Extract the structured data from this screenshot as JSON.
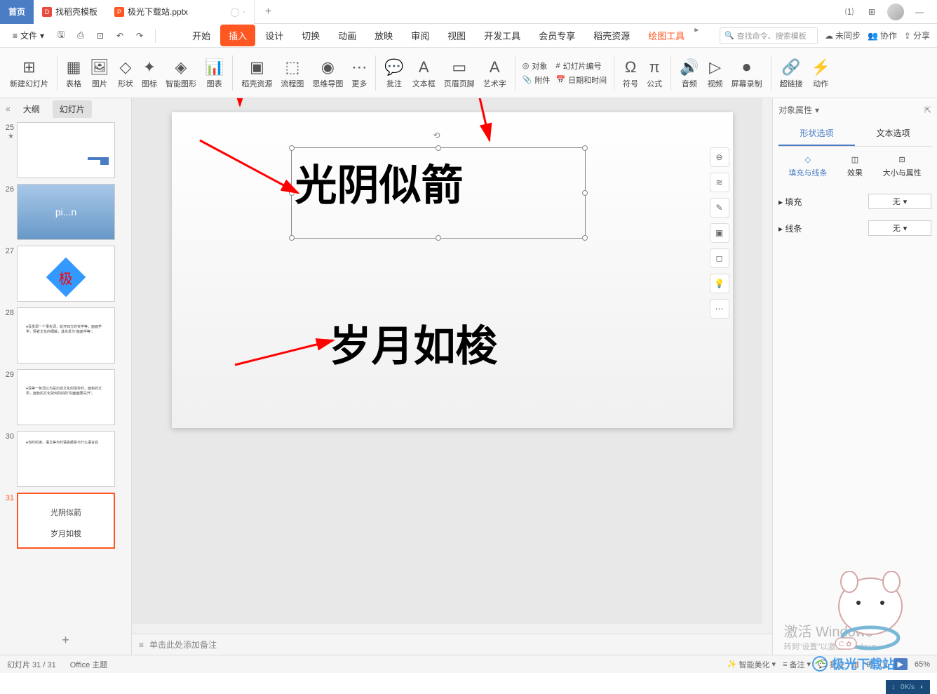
{
  "titlebar": {
    "home": "首页",
    "template": "找稻壳模板",
    "doc_name": "极光下载站.pptx",
    "add": "+"
  },
  "menubar": {
    "file": "文件",
    "tabs": [
      "开始",
      "插入",
      "设计",
      "切换",
      "动画",
      "放映",
      "审阅",
      "视图",
      "开发工具",
      "会员专享",
      "稻壳资源",
      "绘图工具"
    ],
    "active_idx": 1,
    "search_placeholder": "查找命令、搜索模板",
    "unsync": "未同步",
    "collab": "协作",
    "share": "分享"
  },
  "ribbon": {
    "items": [
      {
        "icon": "⊞",
        "label": "新建幻灯片"
      },
      {
        "icon": "▦",
        "label": "表格"
      },
      {
        "icon": "🖼",
        "label": "图片"
      },
      {
        "icon": "◇",
        "label": "形状"
      },
      {
        "icon": "✦",
        "label": "图标"
      },
      {
        "icon": "◈",
        "label": "智能图形"
      },
      {
        "icon": "📊",
        "label": "图表"
      },
      {
        "icon": "▣",
        "label": "稻壳资源"
      },
      {
        "icon": "⬚",
        "label": "流程图"
      },
      {
        "icon": "◉",
        "label": "思维导图"
      },
      {
        "icon": "⋯",
        "label": "更多"
      },
      {
        "icon": "💬",
        "label": "批注"
      },
      {
        "icon": "A",
        "label": "文本框"
      },
      {
        "icon": "▭",
        "label": "页眉页脚"
      },
      {
        "icon": "A",
        "label": "艺术字"
      }
    ],
    "small1": [
      {
        "icon": "◎",
        "label": "对象"
      },
      {
        "icon": "📎",
        "label": "附件"
      }
    ],
    "small2": [
      {
        "icon": "#",
        "label": "幻灯片编号"
      },
      {
        "icon": "📅",
        "label": "日期和时间"
      }
    ],
    "items2": [
      {
        "icon": "Ω",
        "label": "符号"
      },
      {
        "icon": "π",
        "label": "公式"
      },
      {
        "icon": "🔊",
        "label": "音频"
      },
      {
        "icon": "▷",
        "label": "视频"
      },
      {
        "icon": "⏺",
        "label": "屏幕录制"
      },
      {
        "icon": "🔗",
        "label": "超链接"
      },
      {
        "icon": "⚡",
        "label": "动作"
      }
    ]
  },
  "sidebar": {
    "tab_outline": "大纲",
    "tab_slides": "幻灯片",
    "thumbs": [
      {
        "num": "25",
        "star": true
      },
      {
        "num": "26",
        "img": true,
        "text": "pi...n"
      },
      {
        "num": "27",
        "diamond": true,
        "text": "极"
      },
      {
        "num": "28",
        "text": "●没发现一个事实词，就开四方的资学等，面面学学，情者文化的细解，其先发为\"面面学等\"。"
      },
      {
        "num": "29",
        "text": "●没等一色词以为是出自文化的情务时，面色的文学，面色的文化如何的四的\"如面面要先开\"。"
      },
      {
        "num": "30",
        "text": "●当时的读，语文等与时语意都意与什么语言后"
      },
      {
        "num": "31",
        "selected": true,
        "line1": "光阴似箭",
        "line2": "岁月如梭"
      }
    ]
  },
  "canvas": {
    "text1": "光阴似箭",
    "text2": "岁月如梭"
  },
  "notes": {
    "placeholder": "单击此处添加备注"
  },
  "props": {
    "title": "对象属性",
    "tab_shape": "形状选项",
    "tab_text": "文本选项",
    "subtabs": [
      "填充与线条",
      "效果",
      "大小与属性"
    ],
    "fill_label": "填充",
    "fill_value": "无",
    "line_label": "线条",
    "line_value": "无"
  },
  "statusbar": {
    "slide_info": "幻灯片 31 / 31",
    "theme": "Office 主题",
    "beautify": "智能美化",
    "notes": "备注",
    "comment": "批注",
    "zoom": "65%"
  },
  "activate": {
    "title": "激活 Windows",
    "sub": "转到\"设置\"以激活 Windows。"
  },
  "watermark": "极光下载站",
  "netspeed": "0K/s"
}
